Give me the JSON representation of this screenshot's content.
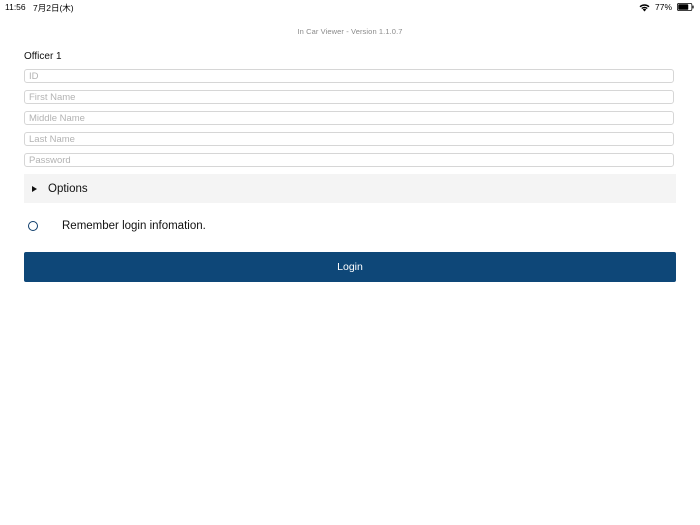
{
  "status_bar": {
    "time": "11:56",
    "date": "7月2日(木)",
    "battery_percent": "77%",
    "battery_level": 0.77
  },
  "app": {
    "title": "In Car Viewer - Version 1.1.0.7"
  },
  "officer": {
    "section_title": "Officer 1",
    "fields": {
      "id": {
        "placeholder": "ID",
        "value": ""
      },
      "first_name": {
        "placeholder": "First Name",
        "value": ""
      },
      "middle_name": {
        "placeholder": "Middle Name",
        "value": ""
      },
      "last_name": {
        "placeholder": "Last Name",
        "value": ""
      },
      "password": {
        "placeholder": "Password",
        "value": ""
      }
    }
  },
  "options": {
    "label": "Options",
    "expanded": false
  },
  "remember": {
    "label": "Remember login infomation.",
    "checked": false
  },
  "login": {
    "label": "Login"
  },
  "colors": {
    "primary": "#0e4778",
    "options_background": "#f4f4f4",
    "field_border": "#d6d6d6",
    "placeholder": "#b3b3b3"
  }
}
